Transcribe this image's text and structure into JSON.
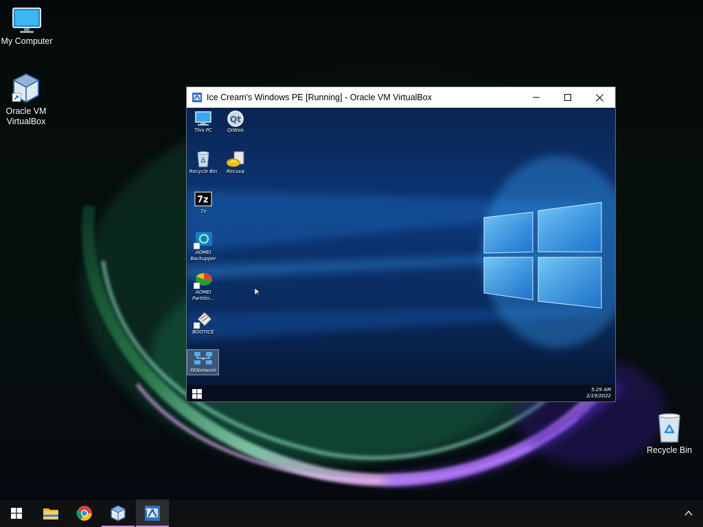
{
  "desktop": {
    "icons": [
      {
        "label": "My Computer",
        "icon": "monitor-icon"
      },
      {
        "label": "Oracle VM\nVirtualBox",
        "icon": "virtualbox-icon"
      },
      {
        "label": "Recycle Bin",
        "icon": "recycle-bin-icon"
      }
    ]
  },
  "vbox_window": {
    "title": "Ice Cream's Windows PE [Running] - Oracle VM VirtualBox",
    "buttons": {
      "minimize": "minimize-icon",
      "maximize": "maximize-icon",
      "close": "close-icon"
    }
  },
  "guest": {
    "icons": [
      {
        "label": "This PC",
        "icon": "this-pc-icon"
      },
      {
        "label": "QtWeb",
        "icon": "qtweb-icon"
      },
      {
        "label": "Recycle Bin",
        "icon": "recycle-bin-icon"
      },
      {
        "label": "Recuva",
        "icon": "recuva-icon"
      },
      {
        "label": "7z",
        "icon": "7zip-icon"
      },
      {
        "label": "AOMEI",
        "label2": "Backupper",
        "icon": "aomei-backupper-icon"
      },
      {
        "label": "AOMEI",
        "label2": "Partitio...",
        "icon": "aomei-partition-icon"
      },
      {
        "label": "BOOTICE",
        "icon": "bootice-icon"
      },
      {
        "label": "PENetwork",
        "icon": "penetwork-icon",
        "selected": true
      }
    ],
    "taskbar": {
      "time": "5:29 AM",
      "date": "2/19/2022"
    }
  },
  "taskbar": {
    "items": [
      {
        "name": "start",
        "icon": "windows-start-icon"
      },
      {
        "name": "file-explorer",
        "icon": "folder-icon"
      },
      {
        "name": "chrome",
        "icon": "chrome-icon"
      },
      {
        "name": "virtualbox-manager",
        "icon": "virtualbox-icon",
        "running": true
      },
      {
        "name": "virtualbox-vm",
        "icon": "virtualbox-vm-icon",
        "running": true,
        "active": true
      }
    ],
    "tray": {
      "overflow_icon": "chevron-up-icon"
    }
  },
  "colors": {
    "accent": "#c58bd6",
    "guest_taskbar": "#0e1424",
    "window_border": "#6b6b6b"
  }
}
